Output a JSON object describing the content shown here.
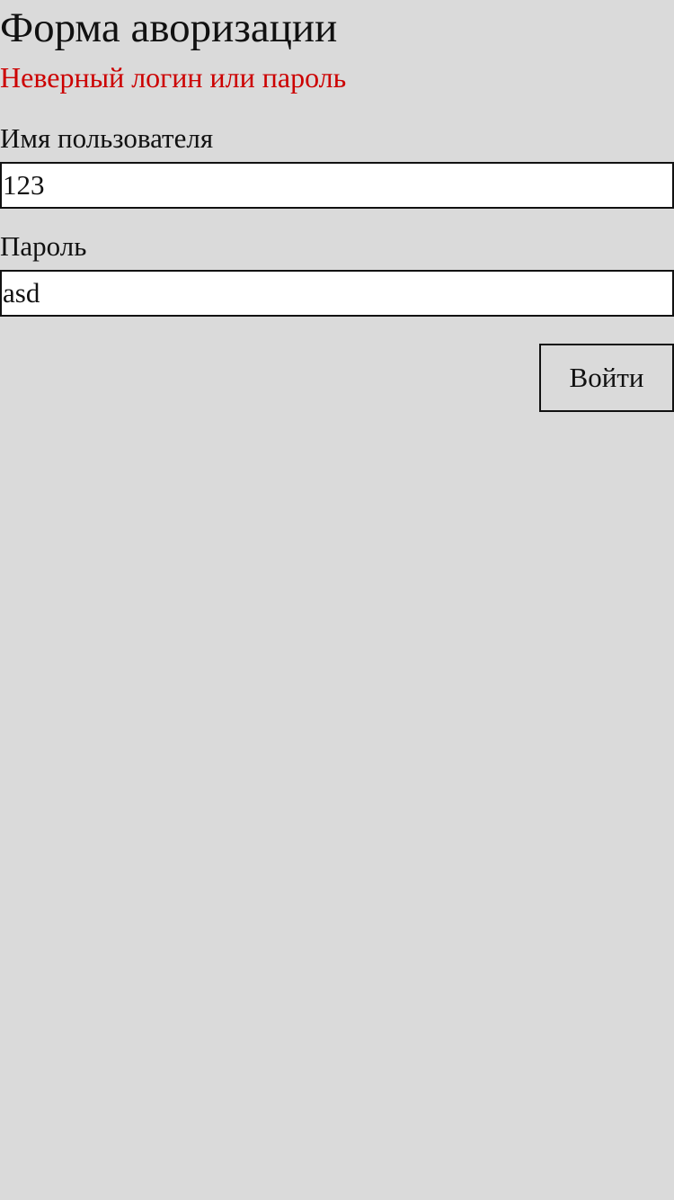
{
  "form": {
    "title": "Форма аворизации",
    "error_message": "Неверный логин или пароль",
    "username": {
      "label": "Имя пользователя",
      "value": "123"
    },
    "password": {
      "label": "Пароль",
      "value": "asd"
    },
    "submit_label": "Войти"
  },
  "colors": {
    "background": "#dadada",
    "text": "#111111",
    "error": "#cc0000",
    "field_background": "#ffffff",
    "border": "#111111"
  }
}
